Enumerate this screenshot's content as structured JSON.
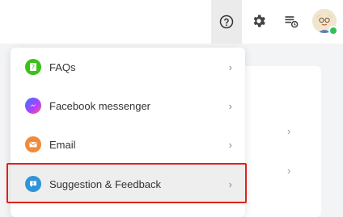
{
  "topbar": {
    "icons": [
      "help-circle-icon",
      "settings-gear-icon",
      "queue-list-icon",
      "user-avatar"
    ],
    "status": "online"
  },
  "menu": {
    "items": [
      {
        "label": "FAQs",
        "icon": "faq-icon",
        "color": "#3cc01a"
      },
      {
        "label": "Facebook messenger",
        "icon": "messenger-icon",
        "color": "#7b4dff"
      },
      {
        "label": "Email",
        "icon": "email-icon",
        "color": "#f08b3b"
      },
      {
        "label": "Suggestion & Feedback",
        "icon": "feedback-icon",
        "color": "#2f95d8"
      }
    ],
    "chevron": "›"
  },
  "colors": {
    "highlight": "#e0201b",
    "online": "#2fc15b"
  }
}
